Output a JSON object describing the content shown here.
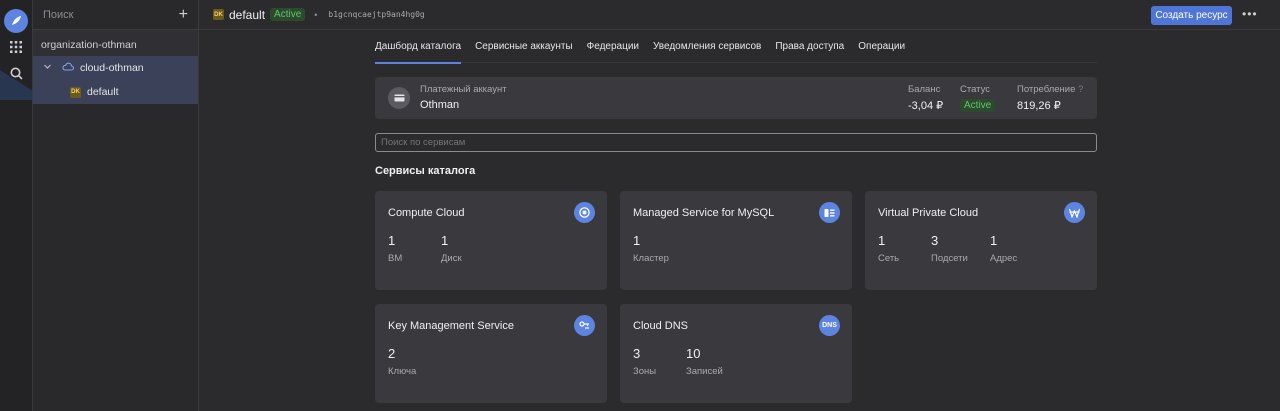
{
  "sidebar": {
    "search_placeholder": "Поиск",
    "organization": "organization-othman",
    "cloud": "cloud-othman",
    "folder": "default",
    "folder_badge": "DK"
  },
  "topbar": {
    "folder_badge": "DK",
    "folder_name": "default",
    "status": "Active",
    "folder_id": "b1gcnqcaejtp9an4hg0g",
    "create_button": "Создать ресурс",
    "more": "•••"
  },
  "tabs": [
    {
      "label": "Дашборд каталога",
      "active": true
    },
    {
      "label": "Сервисные аккаунты"
    },
    {
      "label": "Федерации"
    },
    {
      "label": "Уведомления сервисов"
    },
    {
      "label": "Права доступа"
    },
    {
      "label": "Операции"
    }
  ],
  "billing": {
    "label": "Платежный аккаунт",
    "name": "Othman",
    "balance_label": "Баланс",
    "balance": "-3,04 ₽",
    "status_label": "Статус",
    "status": "Active",
    "consumption_label": "Потребление",
    "consumption": "819,26 ₽",
    "help": "?"
  },
  "search": {
    "placeholder": "Поиск по сервисам"
  },
  "section_title": "Сервисы каталога",
  "cards": [
    {
      "title": "Compute Cloud",
      "icon": "compute-icon",
      "metrics": [
        {
          "n": "1",
          "l": "ВМ"
        },
        {
          "n": "1",
          "l": "Диск"
        }
      ]
    },
    {
      "title": "Managed Service for MySQL",
      "icon": "mysql-icon",
      "metrics": [
        {
          "n": "1",
          "l": "Кластер"
        }
      ]
    },
    {
      "title": "Virtual Private Cloud",
      "icon": "vpc-icon",
      "metrics": [
        {
          "n": "1",
          "l": "Сеть"
        },
        {
          "n": "3",
          "l": "Подсети"
        },
        {
          "n": "1",
          "l": "Адрес"
        }
      ]
    },
    {
      "title": "Key Management Service",
      "icon": "kms-icon",
      "metrics": [
        {
          "n": "2",
          "l": "Ключа"
        }
      ]
    },
    {
      "title": "Cloud DNS",
      "icon": "dns-icon",
      "icon_text": "DNS",
      "metrics": [
        {
          "n": "3",
          "l": "Зоны"
        },
        {
          "n": "10",
          "l": "Записей"
        }
      ]
    }
  ],
  "colors": {
    "accent": "#5c84e0",
    "active_green": "#62c46a",
    "card_bg": "#3a3a3e",
    "page_bg": "#2b2b2e"
  }
}
